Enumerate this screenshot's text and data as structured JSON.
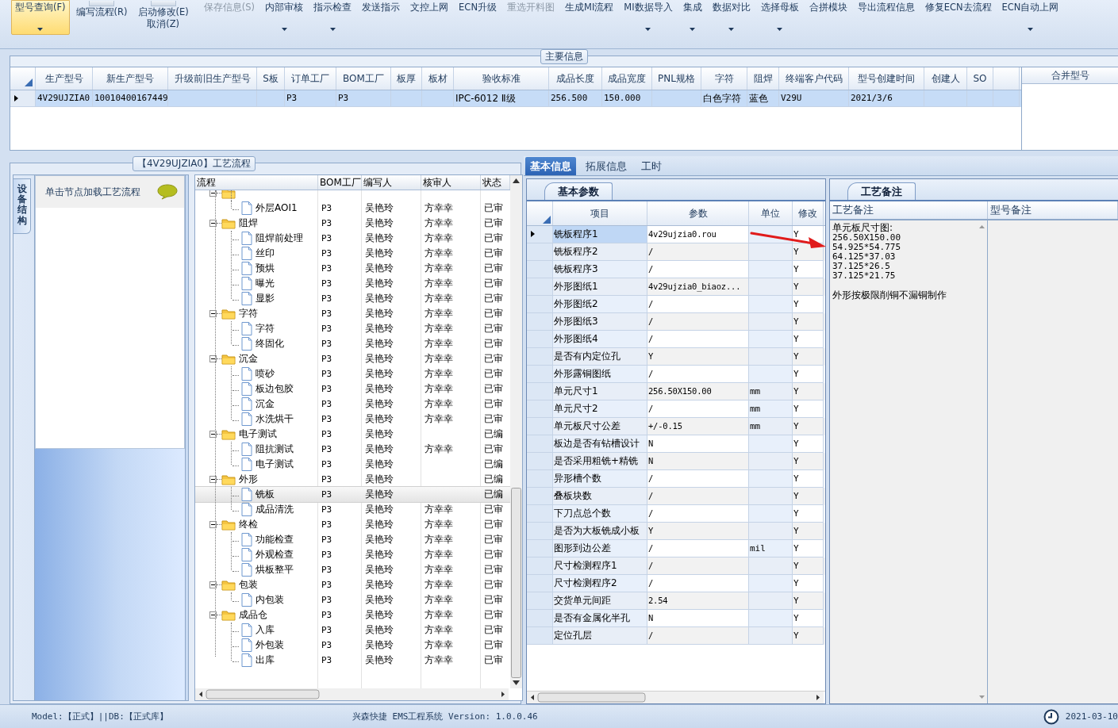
{
  "toolbar": {
    "items": [
      {
        "label": "型号查询(F)",
        "kind": "small",
        "selected": true,
        "disabled": false,
        "dropdown": true
      },
      {
        "label": "编写流程(R)",
        "kind": "large",
        "selected": false,
        "disabled": false,
        "dropdown": false
      },
      {
        "label": "启动修改(E)",
        "sublabel": "取消(Z)",
        "kind": "large",
        "selected": false,
        "disabled": false,
        "dropdown": false
      },
      {
        "label": "保存信息(S)",
        "kind": "small",
        "selected": false,
        "disabled": true,
        "dropdown": false
      },
      {
        "label": "内部审核",
        "kind": "small",
        "selected": false,
        "disabled": false,
        "dropdown": true
      },
      {
        "label": "指示检查",
        "kind": "small",
        "selected": false,
        "disabled": false,
        "dropdown": true
      },
      {
        "label": "发送指示",
        "kind": "small",
        "selected": false,
        "disabled": false,
        "dropdown": false
      },
      {
        "label": "文控上网",
        "kind": "small",
        "selected": false,
        "disabled": false,
        "dropdown": false
      },
      {
        "label": "ECN升级",
        "kind": "small",
        "selected": false,
        "disabled": false,
        "dropdown": false
      },
      {
        "label": "重选开料图",
        "kind": "small",
        "selected": false,
        "disabled": true,
        "dropdown": false
      },
      {
        "label": "生成MI流程",
        "kind": "small",
        "selected": false,
        "disabled": false,
        "dropdown": false
      },
      {
        "label": "MI数据导入",
        "kind": "small",
        "selected": false,
        "disabled": false,
        "dropdown": true
      },
      {
        "label": "集成",
        "kind": "small",
        "selected": false,
        "disabled": false,
        "dropdown": true
      },
      {
        "label": "数据对比",
        "kind": "small",
        "selected": false,
        "disabled": false,
        "dropdown": true
      },
      {
        "label": "选择母板",
        "kind": "small",
        "selected": false,
        "disabled": false,
        "dropdown": true
      },
      {
        "label": "合拼模块",
        "kind": "small",
        "selected": false,
        "disabled": false,
        "dropdown": false
      },
      {
        "label": "导出流程信息",
        "kind": "small",
        "selected": false,
        "disabled": false,
        "dropdown": false
      },
      {
        "label": "修复ECN去流程",
        "kind": "small",
        "selected": false,
        "disabled": false,
        "dropdown": false
      },
      {
        "label": "ECN自动上网",
        "kind": "small",
        "selected": false,
        "disabled": false,
        "dropdown": true
      }
    ]
  },
  "main_info": {
    "title": "主要信息",
    "side_column": "合并型号",
    "columns": [
      "生产型号",
      "新生产型号",
      "升级前旧生产型号",
      "S板",
      "订单工厂",
      "BOM工厂",
      "板厚",
      "板材",
      "验收标准",
      "成品长度",
      "成品宽度",
      "PNL规格",
      "字符",
      "阻焊",
      "终端客户代码",
      "型号创建时间",
      "创建人",
      "SO"
    ],
    "rows": [
      {
        "selected": true,
        "cells": [
          "4V29UJZIA0",
          "10010400167449",
          null,
          null,
          "P3",
          "P3",
          null,
          null,
          "IPC-6012 Ⅱ级",
          "256.500",
          "150.000",
          null,
          "白色字符",
          "蓝色",
          "V29U",
          "2021/3/6",
          null,
          null
        ]
      }
    ]
  },
  "flow": {
    "title": "【4V29UJZIA0】工艺流程",
    "sidebar": {
      "tab": "设备结构",
      "hint": "单击节点加载工艺流程"
    },
    "columns": [
      "流程",
      "BOM工厂",
      "编写人",
      "核审人",
      "状态"
    ],
    "rows": [
      {
        "kind": "folder",
        "expanded": true,
        "selected": false,
        "children": [
          {
            "kind": "file",
            "label": "外层AOI1",
            "bom": "P3",
            "writer": "吴艳玲",
            "reviewer": "方幸幸",
            "status": "已审",
            "selected": false
          }
        ]
      },
      {
        "kind": "folder",
        "label": "阻焊",
        "bom": "P3",
        "writer": "吴艳玲",
        "reviewer": "方幸幸",
        "status": "已审",
        "expanded": true,
        "selected": false,
        "children": [
          {
            "kind": "file",
            "label": "阻焊前处理",
            "bom": "P3",
            "writer": "吴艳玲",
            "reviewer": "方幸幸",
            "status": "已审",
            "selected": false
          },
          {
            "kind": "file",
            "label": "丝印",
            "bom": "P3",
            "writer": "吴艳玲",
            "reviewer": "方幸幸",
            "status": "已审",
            "selected": false
          },
          {
            "kind": "file",
            "label": "预烘",
            "bom": "P3",
            "writer": "吴艳玲",
            "reviewer": "方幸幸",
            "status": "已审",
            "selected": false
          },
          {
            "kind": "file",
            "label": "曝光",
            "bom": "P3",
            "writer": "吴艳玲",
            "reviewer": "方幸幸",
            "status": "已审",
            "selected": false
          },
          {
            "kind": "file",
            "label": "显影",
            "bom": "P3",
            "writer": "吴艳玲",
            "reviewer": "方幸幸",
            "status": "已审",
            "selected": false
          }
        ]
      },
      {
        "kind": "folder",
        "label": "字符",
        "bom": "P3",
        "writer": "吴艳玲",
        "reviewer": "方幸幸",
        "status": "已审",
        "expanded": true,
        "selected": false,
        "children": [
          {
            "kind": "file",
            "label": "字符",
            "bom": "P3",
            "writer": "吴艳玲",
            "reviewer": "方幸幸",
            "status": "已审",
            "selected": false
          },
          {
            "kind": "file",
            "label": "终固化",
            "bom": "P3",
            "writer": "吴艳玲",
            "reviewer": "方幸幸",
            "status": "已审",
            "selected": false
          }
        ]
      },
      {
        "kind": "folder",
        "label": "沉金",
        "bom": "P3",
        "writer": "吴艳玲",
        "reviewer": "方幸幸",
        "status": "已审",
        "expanded": true,
        "selected": false,
        "children": [
          {
            "kind": "file",
            "label": "喷砂",
            "bom": "P3",
            "writer": "吴艳玲",
            "reviewer": "方幸幸",
            "status": "已审",
            "selected": false
          },
          {
            "kind": "file",
            "label": "板边包胶",
            "bom": "P3",
            "writer": "吴艳玲",
            "reviewer": "方幸幸",
            "status": "已审",
            "selected": false
          },
          {
            "kind": "file",
            "label": "沉金",
            "bom": "P3",
            "writer": "吴艳玲",
            "reviewer": "方幸幸",
            "status": "已审",
            "selected": false
          },
          {
            "kind": "file",
            "label": "水洗烘干",
            "bom": "P3",
            "writer": "吴艳玲",
            "reviewer": "方幸幸",
            "status": "已审",
            "selected": false
          }
        ]
      },
      {
        "kind": "folder",
        "label": "电子测试",
        "bom": "P3",
        "writer": "吴艳玲",
        "status": "已编",
        "expanded": true,
        "selected": false,
        "children": [
          {
            "kind": "file",
            "label": "阻抗测试",
            "bom": "P3",
            "writer": "吴艳玲",
            "reviewer": "方幸幸",
            "status": "已审",
            "selected": false
          },
          {
            "kind": "file",
            "label": "电子测试",
            "bom": "P3",
            "writer": "吴艳玲",
            "status": "已编",
            "selected": false
          }
        ]
      },
      {
        "kind": "folder",
        "label": "外形",
        "bom": "P3",
        "writer": "吴艳玲",
        "status": "已编",
        "expanded": true,
        "selected": false,
        "children": [
          {
            "kind": "file",
            "label": "铣板",
            "bom": "P3",
            "writer": "吴艳玲",
            "status": "已编",
            "selected": true
          },
          {
            "kind": "file",
            "label": "成品清洗",
            "bom": "P3",
            "writer": "吴艳玲",
            "reviewer": "方幸幸",
            "status": "已审",
            "selected": false
          }
        ]
      },
      {
        "kind": "folder",
        "label": "终检",
        "bom": "P3",
        "writer": "吴艳玲",
        "reviewer": "方幸幸",
        "status": "已审",
        "expanded": true,
        "selected": false,
        "children": [
          {
            "kind": "file",
            "label": "功能检查",
            "bom": "P3",
            "writer": "吴艳玲",
            "reviewer": "方幸幸",
            "status": "已审",
            "selected": false
          },
          {
            "kind": "file",
            "label": "外观检查",
            "bom": "P3",
            "writer": "吴艳玲",
            "reviewer": "方幸幸",
            "status": "已审",
            "selected": false
          },
          {
            "kind": "file",
            "label": "烘板整平",
            "bom": "P3",
            "writer": "吴艳玲",
            "reviewer": "方幸幸",
            "status": "已审",
            "selected": false
          }
        ]
      },
      {
        "kind": "folder",
        "label": "包装",
        "bom": "P3",
        "writer": "吴艳玲",
        "reviewer": "方幸幸",
        "status": "已审",
        "expanded": true,
        "selected": false,
        "children": [
          {
            "kind": "file",
            "label": "内包装",
            "bom": "P3",
            "writer": "吴艳玲",
            "reviewer": "方幸幸",
            "status": "已审",
            "selected": false
          }
        ]
      },
      {
        "kind": "folder",
        "label": "成品仓",
        "bom": "P3",
        "writer": "吴艳玲",
        "reviewer": "方幸幸",
        "status": "已审",
        "expanded": true,
        "selected": false,
        "children": [
          {
            "kind": "file",
            "label": "入库",
            "bom": "P3",
            "writer": "吴艳玲",
            "reviewer": "方幸幸",
            "status": "已审",
            "selected": false
          },
          {
            "kind": "file",
            "label": "外包装",
            "bom": "P3",
            "writer": "吴艳玲",
            "reviewer": "方幸幸",
            "status": "已审",
            "selected": false
          },
          {
            "kind": "file",
            "label": "出库",
            "bom": "P3",
            "writer": "吴艳玲",
            "reviewer": "方幸幸",
            "status": "已审",
            "selected": false
          }
        ]
      }
    ]
  },
  "detail": {
    "tabs": [
      {
        "label": "基本信息",
        "selected": true
      },
      {
        "label": "拓展信息",
        "selected": false
      },
      {
        "label": "工时",
        "selected": false
      }
    ],
    "params": {
      "tab": "基本参数",
      "columns": [
        "项目",
        "参数",
        "单位",
        "修改"
      ],
      "rows": [
        {
          "item": "铣板程序1",
          "value": "4v29ujzia0.rou",
          "modified": "Y",
          "selected": true
        },
        {
          "item": "铣板程序2",
          "value": "/",
          "modified": "Y",
          "selected": false
        },
        {
          "item": "铣板程序3",
          "value": "/",
          "modified": "Y",
          "selected": false
        },
        {
          "item": "外形图纸1",
          "value": "4v29ujzia0_biaoz...",
          "modified": "Y",
          "selected": false
        },
        {
          "item": "外形图纸2",
          "value": "/",
          "modified": "Y",
          "selected": false
        },
        {
          "item": "外形图纸3",
          "value": "/",
          "modified": "Y",
          "selected": false
        },
        {
          "item": "外形图纸4",
          "value": "/",
          "modified": "Y",
          "selected": false
        },
        {
          "item": "是否有内定位孔",
          "value": "Y",
          "modified": "Y",
          "selected": false
        },
        {
          "item": "外形露铜图纸",
          "value": "/",
          "modified": "Y",
          "selected": false
        },
        {
          "item": "单元尺寸1",
          "value": "256.50X150.00",
          "unit": "mm",
          "modified": "Y",
          "selected": false
        },
        {
          "item": "单元尺寸2",
          "value": "/",
          "unit": "mm",
          "modified": "Y",
          "selected": false
        },
        {
          "item": "单元板尺寸公差",
          "value": "+/-0.15",
          "unit": "mm",
          "modified": "Y",
          "selected": false
        },
        {
          "item": "板边是否有钻槽设计",
          "value": "N",
          "modified": "Y",
          "selected": false
        },
        {
          "item": "是否采用粗铣+精铣",
          "value": "N",
          "modified": "Y",
          "selected": false
        },
        {
          "item": "异形槽个数",
          "value": "/",
          "modified": "Y",
          "selected": false
        },
        {
          "item": "叠板块数",
          "value": "/",
          "modified": "Y",
          "selected": false
        },
        {
          "item": "下刀点总个数",
          "value": "/",
          "modified": "Y",
          "selected": false
        },
        {
          "item": "是否为大板铣成小板",
          "value": "Y",
          "modified": "Y",
          "selected": false
        },
        {
          "item": "图形到边公差",
          "value": "/",
          "unit": "mil",
          "modified": "Y",
          "selected": false
        },
        {
          "item": "尺寸检测程序1",
          "value": "/",
          "modified": "Y",
          "selected": false
        },
        {
          "item": "尺寸检测程序2",
          "value": "/",
          "modified": "Y",
          "selected": false
        },
        {
          "item": "交货单元间距",
          "value": "2.54",
          "modified": "Y",
          "selected": false
        },
        {
          "item": "是否有金属化半孔",
          "value": "N",
          "modified": "Y",
          "selected": false
        },
        {
          "item": "定位孔层",
          "value": "/",
          "modified": "Y",
          "selected": false
        }
      ]
    },
    "notes": {
      "tab": "工艺备注",
      "columns": [
        "工艺备注",
        "型号备注"
      ],
      "blocks": [
        [
          "单元板尺寸图:",
          "256.50X150.00",
          "54.925*54.775",
          "64.125*37.03",
          "37.125*26.5",
          "37.125*21.75"
        ],
        [
          "外形按极限削铜不漏铜制作"
        ]
      ]
    }
  },
  "status_bar": {
    "left": "Model:【正式】||DB:【正式库】",
    "center": "兴森快捷 EMS工程系统 Version: 1.0.0.46",
    "date": "2021-03-10"
  }
}
